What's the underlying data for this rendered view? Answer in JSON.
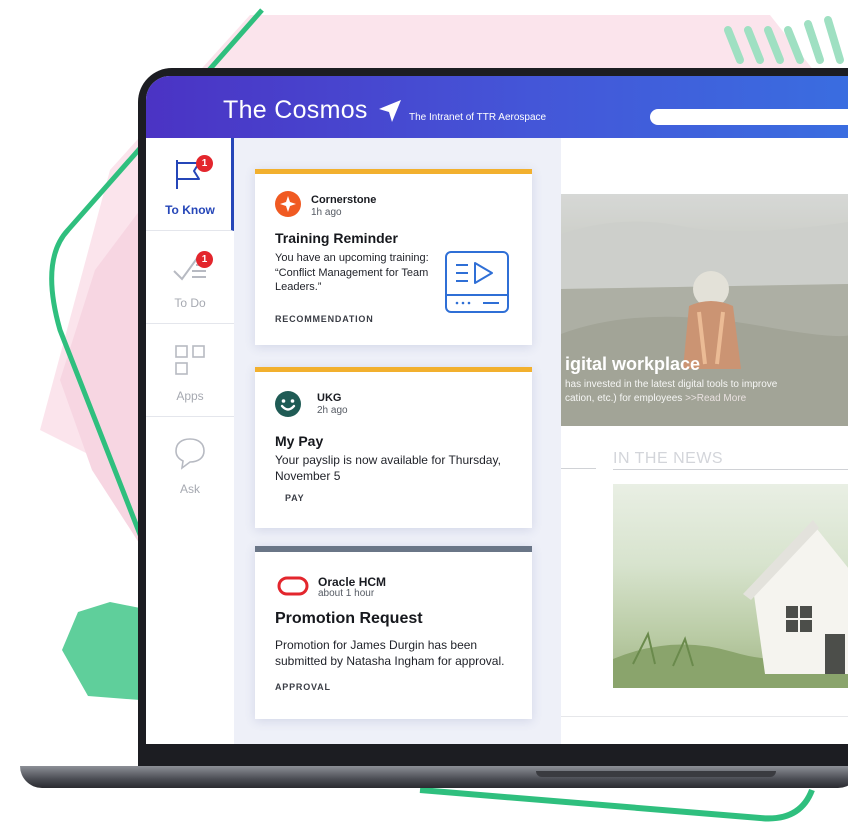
{
  "app": {
    "title": "The Cosmos",
    "subtitle": "The Intranet of TTR Aerospace"
  },
  "nav": {
    "items": [
      {
        "label": "To Know",
        "badge": "1",
        "active": true,
        "icon": "flag-icon"
      },
      {
        "label": "To Do",
        "badge": "1",
        "active": false,
        "icon": "checklist-icon"
      },
      {
        "label": "Apps",
        "badge": "",
        "active": false,
        "icon": "apps-grid-icon"
      },
      {
        "label": "Ask",
        "badge": "",
        "active": false,
        "icon": "chat-bubbles-icon"
      }
    ]
  },
  "feed": {
    "cards": [
      {
        "source": "Cornerstone",
        "time": "1h ago",
        "title": "Training Reminder",
        "body": "You have an upcoming training: “Conflict Management for Team Leaders.”",
        "tag": "RECOMMENDATION",
        "accent_color": "#f2b02e",
        "logo_color": "#f05a22",
        "icon": "video-training-icon"
      },
      {
        "source": "UKG",
        "time": "2h ago",
        "title": "My Pay",
        "body": "Your payslip is now available for Thursday, November 5",
        "tag": "PAY",
        "accent_color": "#f2b02e",
        "logo_color": "#1f5b55"
      },
      {
        "source": "Oracle HCM",
        "time": "about 1 hour",
        "title": "Promotion Request",
        "body": "Promotion for James Durgin has been submitted by Natasha Ingham for approval.",
        "tag": "APPROVAL",
        "accent_color": "#6a7687",
        "logo_color": "#e3262d"
      }
    ]
  },
  "content": {
    "hero_title": "igital workplace",
    "hero_text": "has invested in the latest digital tools to improve",
    "hero_text2": "cation, etc.) for employees",
    "read_more": ">>Read More",
    "news_heading": "IN THE NEWS"
  },
  "colors": {
    "header_start": "#4b33c4",
    "header_end": "#3a6de0",
    "nav_active": "#2546b8",
    "badge": "#e3262d"
  }
}
